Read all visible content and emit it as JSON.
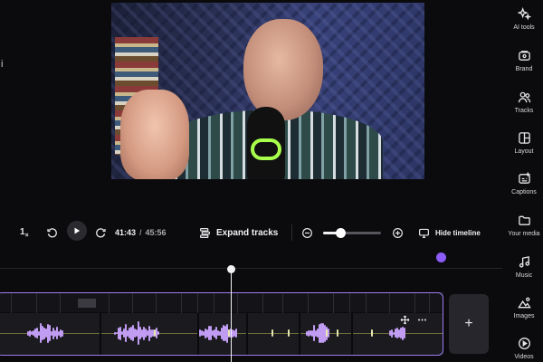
{
  "preview": {
    "stray_char": "i"
  },
  "sidebar": {
    "items": [
      {
        "label": "AI tools",
        "icon": "sparkles-icon"
      },
      {
        "label": "Brand",
        "icon": "brand-kit-icon"
      },
      {
        "label": "Tracks",
        "icon": "users-icon"
      },
      {
        "label": "Layout",
        "icon": "layout-icon"
      },
      {
        "label": "Captions",
        "icon": "captions-icon"
      },
      {
        "label": "Your media",
        "icon": "folder-icon"
      },
      {
        "label": "Music",
        "icon": "music-note-icon"
      },
      {
        "label": "Images",
        "icon": "image-icon"
      },
      {
        "label": "Videos",
        "icon": "video-play-icon"
      }
    ]
  },
  "toolbar": {
    "speed": "1",
    "speed_suffix": "×",
    "current_time": "41:43",
    "separator": "/",
    "total_time": "45:56",
    "expand_label": "Expand tracks",
    "zoom_level": 0.3,
    "hide_timeline_label": "Hide timeline"
  },
  "timeline": {
    "add_track_label": "+",
    "playhead_time": "41:43"
  },
  "colors": {
    "accent": "#8b5cf6",
    "waveform": "#c19cf3",
    "clip_border": "#9a7cf2",
    "background": "#0b0b0d"
  }
}
